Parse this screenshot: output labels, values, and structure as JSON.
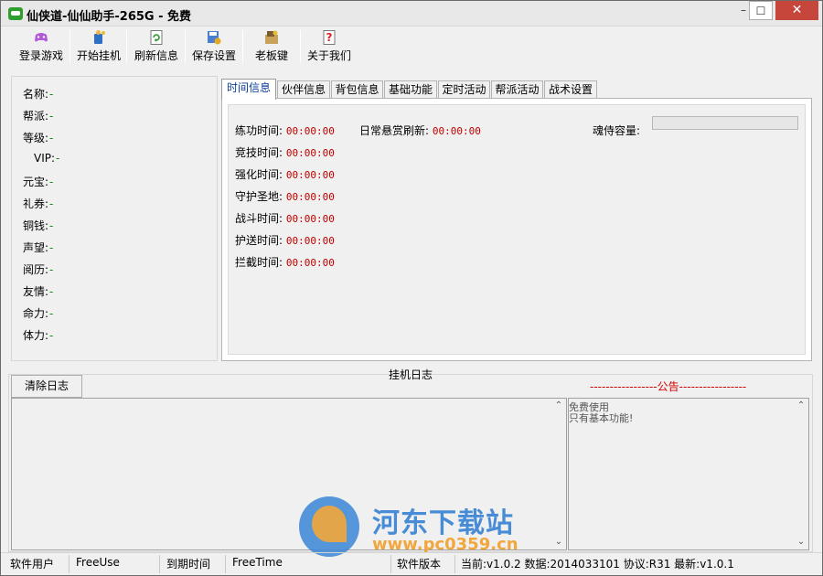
{
  "window": {
    "title": "仙侠道-仙仙助手-265G - 免费",
    "minimize": "–",
    "maximize": "☐",
    "close": "✕"
  },
  "toolbar": {
    "items": [
      {
        "label": "登录游戏",
        "icon": "controller-icon"
      },
      {
        "label": "开始挂机",
        "icon": "person-run-icon"
      },
      {
        "label": "刷新信息",
        "icon": "refresh-icon"
      },
      {
        "label": "保存设置",
        "icon": "save-settings-icon"
      },
      {
        "label": "老板键",
        "icon": "boss-key-icon"
      },
      {
        "label": "关于我们",
        "icon": "help-icon"
      }
    ]
  },
  "info": {
    "rows": [
      {
        "label": "名称:",
        "value": "-"
      },
      {
        "label": "帮派:",
        "value": "-"
      },
      {
        "label": "等级:",
        "value": "-"
      },
      {
        "label": "VIP:",
        "value": "-"
      },
      {
        "label": "元宝:",
        "value": "-"
      },
      {
        "label": "礼券:",
        "value": "-"
      },
      {
        "label": "铜钱:",
        "value": "-"
      },
      {
        "label": "声望:",
        "value": "-"
      },
      {
        "label": "阅历:",
        "value": "-"
      },
      {
        "label": "友情:",
        "value": "-"
      },
      {
        "label": "命力:",
        "value": "-"
      },
      {
        "label": "体力:",
        "value": "-"
      }
    ]
  },
  "tabs": [
    "时间信息",
    "伙伴信息",
    "背包信息",
    "基础功能",
    "定时活动",
    "帮派活动",
    "战术设置"
  ],
  "active_tab": "时间信息",
  "time_info": {
    "rows": [
      {
        "label": "练功时间:",
        "value": "00:00:00"
      },
      {
        "label": "竞技时间:",
        "value": "00:00:00"
      },
      {
        "label": "强化时间:",
        "value": "00:00:00"
      },
      {
        "label": "守护圣地:",
        "value": "00:00:00"
      },
      {
        "label": "战斗时间:",
        "value": "00:00:00"
      },
      {
        "label": "护送时间:",
        "value": "00:00:00"
      },
      {
        "label": "拦截时间:",
        "value": "00:00:00"
      }
    ],
    "daily_refresh_label": "日常悬赏刷新:",
    "daily_refresh_value": "00:00:00",
    "soul_capacity_label": "魂侍容量:",
    "soul_capacity_fill": 0
  },
  "log": {
    "title": "挂机日志",
    "clear_button": "清除日志",
    "notice_title": "-----------------公告-----------------",
    "notice_lines": [
      "免费使用",
      "只有基本功能!"
    ]
  },
  "watermark": {
    "title": "河东下载站",
    "url": "www.pc0359.cn"
  },
  "status": {
    "user_label": "软件用户",
    "user_value": "FreeUse",
    "expire_label": "到期时间",
    "expire_value": "FreeTime",
    "version_label": "软件版本",
    "version_info": "当前:v1.0.2  数据:2014033101  协议:R31  最新:v1.0.1"
  },
  "colors": {
    "close_button": "#c7463c",
    "time_value": "#c00000",
    "info_value": "#118a11",
    "notice_title": "#d40000",
    "active_tab_text": "#0a3d9e"
  }
}
